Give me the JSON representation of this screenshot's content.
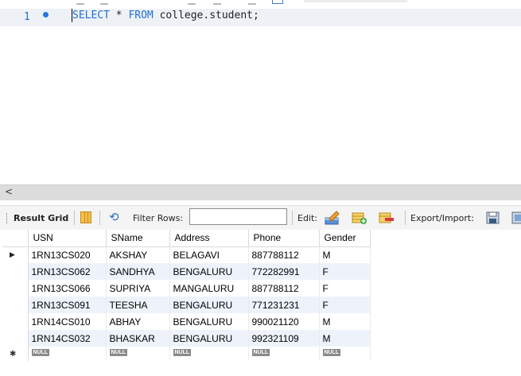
{
  "editor": {
    "line_number": "1",
    "sql_kw1": "SELECT",
    "sql_star": " * ",
    "sql_kw2": "FROM",
    "sql_rest": " college.student;"
  },
  "scrollbar": {
    "left_arrow": "<"
  },
  "result_toolbar": {
    "result_grid_label": "Result Grid",
    "filter_rows_label": "Filter Rows:",
    "filter_value": "",
    "edit_label": "Edit:",
    "export_import_label": "Export/Import:"
  },
  "grid": {
    "columns": [
      "USN",
      "SName",
      "Address",
      "Phone",
      "Gender"
    ],
    "rows": [
      [
        "1RN13CS020",
        "AKSHAY",
        "BELAGAVI",
        "887788112",
        "M"
      ],
      [
        "1RN13CS062",
        "SANDHYA",
        "BENGALURU",
        "772282991",
        "F"
      ],
      [
        "1RN13CS066",
        "SUPRIYA",
        "MANGALURU",
        "887788112",
        "F"
      ],
      [
        "1RN13CS091",
        "TEESHA",
        "BENGALURU",
        "771231231",
        "F"
      ],
      [
        "1RN14CS010",
        "ABHAY",
        "BENGALURU",
        "990021120",
        "M"
      ],
      [
        "1RN14CS032",
        "BHASKAR",
        "BENGALURU",
        "992321109",
        "M"
      ]
    ],
    "null_label": "NULL",
    "current_row_marker": "▶",
    "new_row_marker": "✱"
  },
  "colors": {
    "keyword": "#1f6fd1",
    "line_highlight": "#eef2f7",
    "row_alt": "#eef3fb"
  }
}
